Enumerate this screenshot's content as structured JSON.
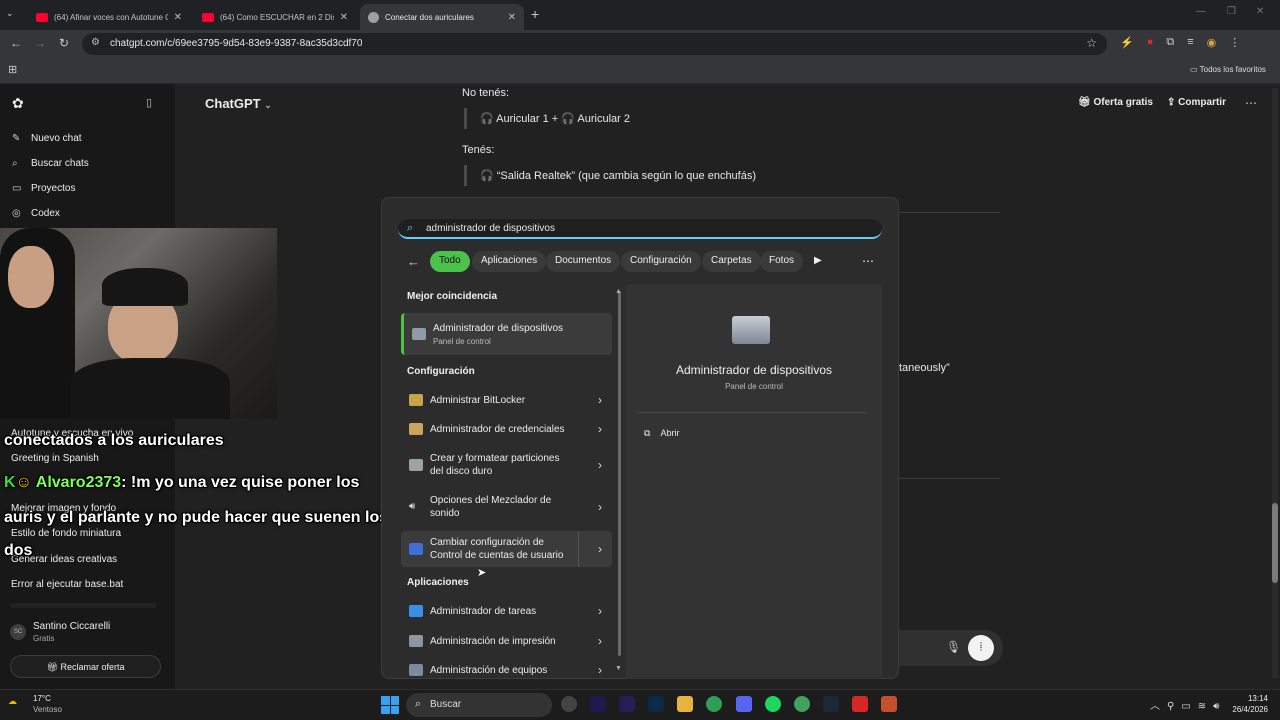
{
  "browser": {
    "tabs": [
      {
        "title": "(64) Afinar voces con Autotune Gr"
      },
      {
        "title": "(64) Como ESCUCHAR en 2 Dispos"
      },
      {
        "title": "Conectar dos auriculares"
      }
    ],
    "url": "chatgpt.com/c/69ee3795-9d54-83e9-9387-8ac35d3cdf70",
    "bookmarks_label": "Todos los favoritos"
  },
  "sidebar": {
    "nav": [
      {
        "label": "Nuevo chat",
        "icon": "edit-icon"
      },
      {
        "label": "Buscar chats",
        "icon": "search-icon"
      },
      {
        "label": "Proyectos",
        "icon": "folder-icon"
      },
      {
        "label": "Codex",
        "icon": "codex-icon"
      }
    ],
    "history": [
      "Autotune y escucha en vivo",
      "Greeting in Spanish",
      "Mejorar imagen y fondo",
      "Estilo de fondo miniatura",
      "Generar ideas creativas",
      "Error al ejecutar base.bat"
    ],
    "user": {
      "initials": "SC",
      "name": "Santino Ciccarelli",
      "plan": "Gratis"
    },
    "claim": "Reclamar oferta"
  },
  "header": {
    "model": "ChatGPT",
    "offer": "Oferta gratis",
    "share": "Compartir"
  },
  "chat": {
    "line1": "No tenés:",
    "quote1": "🎧 Auricular 1 + 🎧 Auricular 2",
    "line2": "Tenés:",
    "quote2": "🎧 “Salida Realtek” (que cambia según lo que enchufás)",
    "fragment": "taneously”"
  },
  "overlay": {
    "line1": "conectados a los auriculares",
    "user": "Alvaro2373",
    "msg1": ": !m yo una vez quise poner los",
    "msg2": "auris y el parlante y no pude hacer que suenen los",
    "msg3": "dos"
  },
  "search": {
    "query": "administrador de dispositivos",
    "filters": [
      "Todo",
      "Aplicaciones",
      "Documentos",
      "Configuración",
      "Carpetas",
      "Fotos"
    ],
    "best_match_heading": "Mejor coincidencia",
    "best_match": {
      "title": "Administrador de dispositivos",
      "subtitle": "Panel de control"
    },
    "settings_heading": "Configuración",
    "settings": [
      {
        "label": "Administrar BitLocker"
      },
      {
        "label": "Administrador de credenciales"
      },
      {
        "label1": "Crear y formatear particiones",
        "label2": "del disco duro"
      },
      {
        "label1": "Opciones del Mezclador de",
        "label2": "sonido"
      },
      {
        "label1": "Cambiar configuración de",
        "label2": "Control de cuentas de usuario"
      }
    ],
    "apps_heading": "Aplicaciones",
    "apps": [
      "Administrador de tareas",
      "Administración de impresión",
      "Administración de equipos"
    ],
    "preview": {
      "title": "Administrador de dispositivos",
      "subtitle": "Panel de control",
      "action": "Abrir"
    }
  },
  "taskbar": {
    "weather_temp": "17°C",
    "weather_desc": "Ventoso",
    "search_placeholder": "Buscar",
    "time": "13:14",
    "date": "26/4/2026"
  }
}
